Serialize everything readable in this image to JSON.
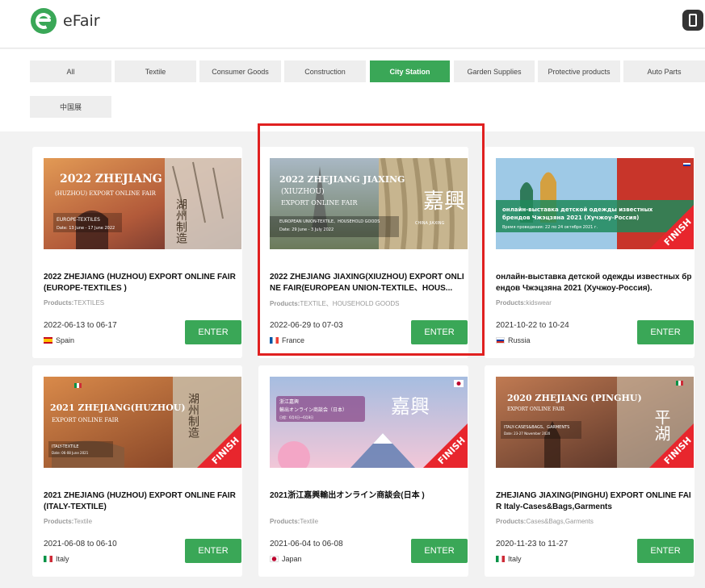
{
  "header": {
    "logo_text": "eFair"
  },
  "filters": [
    "All",
    "Textile",
    "Consumer Goods",
    "Construction",
    "City Station",
    "Garden Supplies",
    "Protective products",
    "Auto Parts",
    "中国展"
  ],
  "active_filter": "City Station",
  "button_label": "ENTER",
  "products_label": "Products:",
  "finish_label": "FINISH",
  "cards": [
    {
      "banner": {
        "line1": "2022 ZHEJIANG",
        "line2": "(HUZHOU) EXPORT ONLINE FAIR",
        "line3": "EUROPE-TEXTILES",
        "line4": "Date: 13 June - 17 June 2022",
        "calligraphy": "湖州制造"
      },
      "title": "2022 ZHEJIANG (HUZHOU) EXPORT ONLINE FAIR (EUROPE-TEXTILES )",
      "products": "TEXTILES",
      "dates": "2022-06-13 to 06-17",
      "country": "Spain",
      "flag": "spain",
      "finished": false
    },
    {
      "banner": {
        "line1": "2022 ZHEJIANG JIAXING",
        "line2": "(XIUZHOU)",
        "line3": "EXPORT ONLINE FAIR",
        "line4": "EUROPEAN UNION-TEXTILE、HOUSEHOLD GOODS",
        "line5": "Date: 29 June - 3 July 2022",
        "calligraphy": "嘉興",
        "tag": "CHINA JIAXING"
      },
      "title": "2022 ZHEJIANG JIAXING(XIUZHOU) EXPORT ONLINE FAIR(EUROPEAN UNION-TEXTILE、HOUS...",
      "products": "TEXTILE、HOUSEHOLD GOODS",
      "dates": "2022-06-29 to 07-03",
      "country": "France",
      "flag": "france",
      "finished": false
    },
    {
      "banner": {
        "line1": "онлайн-выставка детской одежды известных",
        "line2": "брендов Чжэцзяна 2021 (Хучжоу-Россия)",
        "line3": "Время проведения: 22 по 24 октября 2021 г."
      },
      "title": "онлайн-выставка детской одежды известных брендов Чжэцзяна 2021 (Хучжоу-Россия).",
      "products": "kidswear",
      "dates": "2021-10-22 to 10-24",
      "country": "Russia",
      "flag": "russia",
      "finished": true
    },
    {
      "banner": {
        "line1": "2021 ZHEJIANG(HUZHOU)",
        "line2": "EXPORT ONLINE FAIR",
        "line3": "ITALY-TEXTILE",
        "line4": "Date: 06-08 June 2021",
        "calligraphy": "湖州制造"
      },
      "title": "2021 ZHEJIANG (HUZHOU) EXPORT ONLINE FAIR (ITALY-TEXTILE)",
      "products": "Textile",
      "dates": "2021-06-08 to 06-10",
      "country": "Italy",
      "flag": "italy",
      "finished": true
    },
    {
      "banner": {
        "line1": "浙江嘉興",
        "line2": "輸出オンライン商談会（日本）",
        "line3": "日程：6月4日～6月8日",
        "calligraphy": "嘉興"
      },
      "title": "2021浙江嘉興輸出オンライン商談会(日本 )",
      "products": "Textile",
      "dates": "2021-06-04 to 06-08",
      "country": "Japan",
      "flag": "japan",
      "finished": true
    },
    {
      "banner": {
        "line1": "2020 ZHEJIANG (PINGHU)",
        "line2": "EXPORT ONLINE FAIR",
        "line3": "ITALY-CASES&BAGS、GARMENTS",
        "line4": "Date: 23-27 November 2020",
        "calligraphy": "平湖"
      },
      "title": "ZHEJIANG JIAXING(PINGHU) EXPORT ONLINE FAIR Italy-Cases&Bags,Garments",
      "products": "Cases&Bags,Garments",
      "dates": "2020-11-23 to 11-27",
      "country": "Italy",
      "flag": "italy",
      "finished": true
    }
  ],
  "colors": {
    "accent": "#3aa757",
    "highlight": "#e02020",
    "finish_ribbon": "#e8262d"
  }
}
